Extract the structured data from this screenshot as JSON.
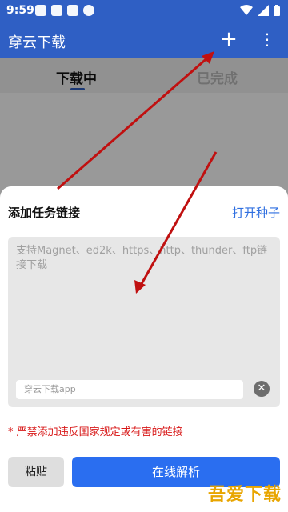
{
  "status_bar": {
    "time": "9:59"
  },
  "app_bar": {
    "title": "穿云下载"
  },
  "tabs": [
    {
      "label": "下载中",
      "active": true
    },
    {
      "label": "已完成",
      "active": false
    }
  ],
  "sheet": {
    "title": "添加任务链接",
    "open_seed_label": "打开种子",
    "input_placeholder": "支持Magnet、ed2k、https、http、thunder、ftp链接下载",
    "sub_input_placeholder": "穿云下载app",
    "warning": "* 严禁添加违反国家规定或有害的链接",
    "paste_label": "粘贴",
    "parse_label": "在线解析"
  },
  "watermark": "吾爱下载",
  "colors": {
    "primary": "#2f5fc4",
    "accent_blue": "#2a6ef0",
    "warning_red": "#d81818",
    "watermark": "#e8a500"
  }
}
